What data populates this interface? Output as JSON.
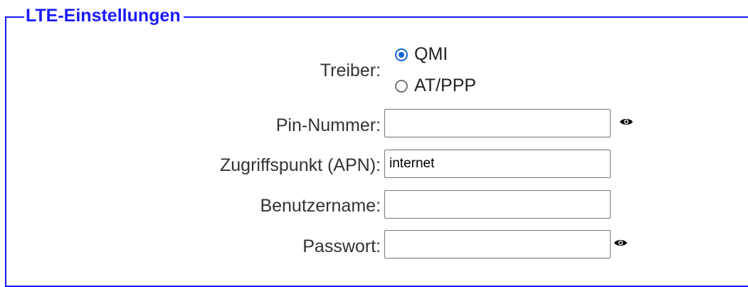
{
  "section": {
    "title": "LTE-Einstellungen"
  },
  "driver": {
    "label": "Treiber:",
    "options": [
      {
        "label": "QMI",
        "selected": true
      },
      {
        "label": "AT/PPP",
        "selected": false
      }
    ]
  },
  "pin": {
    "label": "Pin-Nummer:",
    "value": "",
    "toggle_icon": "eye-icon"
  },
  "apn": {
    "label": "Zugriffspunkt (APN):",
    "value": "internet"
  },
  "username": {
    "label": "Benutzername:",
    "value": ""
  },
  "password": {
    "label": "Passwort:",
    "value": "",
    "toggle_icon": "eye-icon"
  },
  "colors": {
    "border": "#1a1aff",
    "legend_text": "#1a1aff",
    "radio_accent": "#1665d8"
  }
}
